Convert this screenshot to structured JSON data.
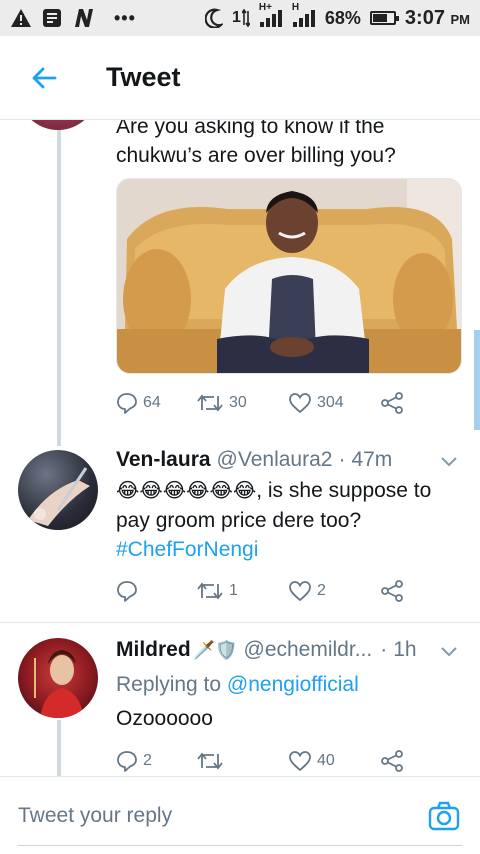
{
  "status_bar": {
    "left_icons": [
      "warning-icon",
      "message-icon",
      "n-app-icon"
    ],
    "dots": "•••",
    "signal_one": "1",
    "signal_h_plus": "H+",
    "signal_h": "H",
    "battery": "68%",
    "battery_level_percent": 68,
    "time": "3:07",
    "time_suffix": "PM"
  },
  "app_bar": {
    "title": "Tweet",
    "back_icon": "arrow-left-icon"
  },
  "tweets": [
    {
      "text": "Are you asking to know if the chukwu’s are  over billing you?",
      "image_icon": "photo-man-on-gold-sofa",
      "replies": "64",
      "retweets": "30",
      "likes": "304"
    },
    {
      "name": "Ven-laura",
      "handle": "@Venlaura2",
      "sep": "·",
      "time": "47m",
      "emoji": "😂😂😂😂😂😂",
      "text": ", is she suppose to pay groom price dere too?",
      "hashtag": "#ChefForNengi",
      "replies": "",
      "retweets": "1",
      "likes": "2"
    },
    {
      "name": "Mildred",
      "name_badges": "🗡️🛡️",
      "handle": "@echemildr...",
      "sep": "·",
      "time": "1h",
      "replying_label": "Replying to",
      "replying_handle": "@nengiofficial",
      "text": "Ozoooooo",
      "replies": "2",
      "retweets": "",
      "likes": "40"
    }
  ],
  "reply_bar": {
    "placeholder": "Tweet your reply",
    "camera_icon": "camera-icon"
  },
  "colors": {
    "accent": "#1da1f2",
    "secondary_text": "#657786",
    "divider": "#e1e8ed"
  }
}
